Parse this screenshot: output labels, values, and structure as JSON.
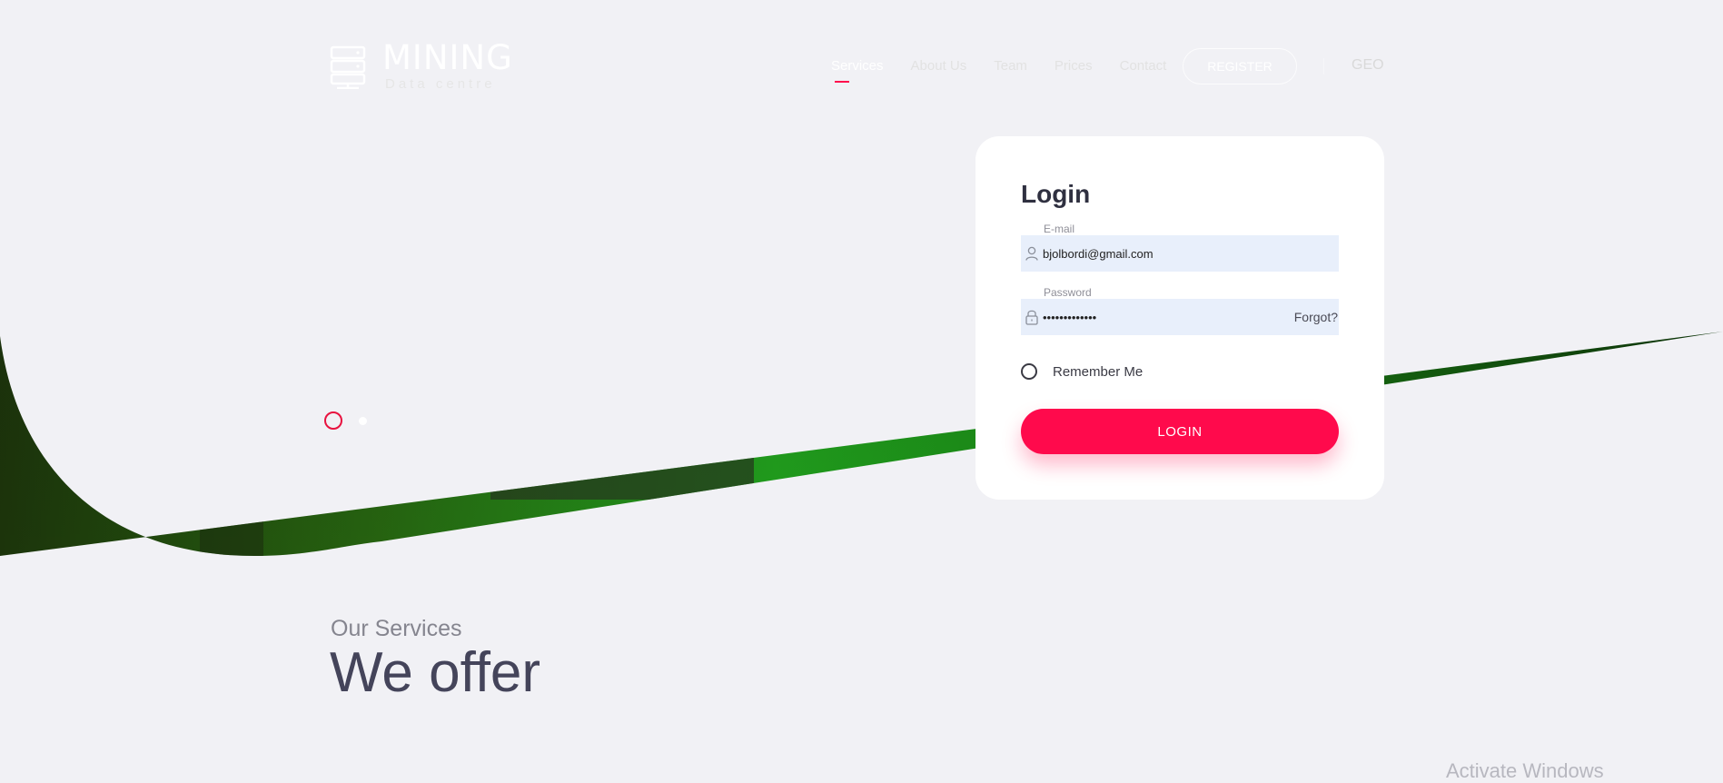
{
  "brand": {
    "title": "MINING",
    "subtitle": "Data centre"
  },
  "nav": {
    "items": [
      {
        "label": "Services",
        "active": true
      },
      {
        "label": "About Us",
        "active": false
      },
      {
        "label": "Team",
        "active": false
      },
      {
        "label": "Prices",
        "active": false
      },
      {
        "label": "Contact",
        "active": false
      }
    ],
    "register_label": "REGISTER",
    "language": "GEO"
  },
  "slider": {
    "total": 2,
    "active_index": 0
  },
  "login": {
    "title": "Login",
    "email_label": "E-mail",
    "email_value": "bjolbordi@gmail.com",
    "password_label": "Password",
    "password_value": "•••••••••••••",
    "forgot_label": "Forgot?",
    "remember_label": "Remember Me",
    "remember_checked": false,
    "submit_label": "LOGIN"
  },
  "services": {
    "subtitle": "Our Services",
    "title": "We offer"
  },
  "watermark": "Activate Windows",
  "colors": {
    "accent": "#ff0a4c",
    "hero_green": "#2bd12b",
    "background": "#f1f1f5",
    "field_bg": "#e8effb"
  },
  "icons": [
    "server-rack-icon",
    "user-icon",
    "lock-icon"
  ]
}
